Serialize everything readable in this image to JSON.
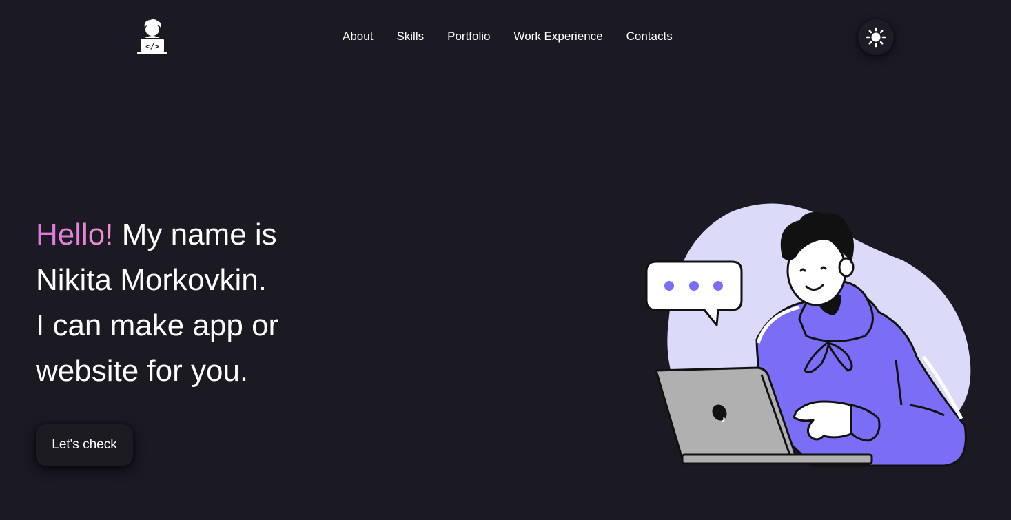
{
  "header": {
    "logo_icon": "developer-laptop-icon",
    "nav": [
      {
        "label": "About"
      },
      {
        "label": "Skills"
      },
      {
        "label": "Portfolio"
      },
      {
        "label": "Work Experience"
      },
      {
        "label": "Contacts"
      }
    ],
    "theme_toggle_icon": "sun-icon"
  },
  "hero": {
    "greeting": "Hello!",
    "line1_rest": " My name is",
    "line2": "Nikita Morkovkin.",
    "line3": "I can make app or",
    "line4": "website for you.",
    "cta_label": "Let's check",
    "illustration_icon": "developer-with-laptop-illustration"
  },
  "colors": {
    "background": "#1b1a23",
    "accent_purple": "#7b6ef6",
    "blob": "#dcdaf9",
    "greeting_gradient_start": "#d778e0",
    "greeting_gradient_end": "#f08fd0"
  }
}
